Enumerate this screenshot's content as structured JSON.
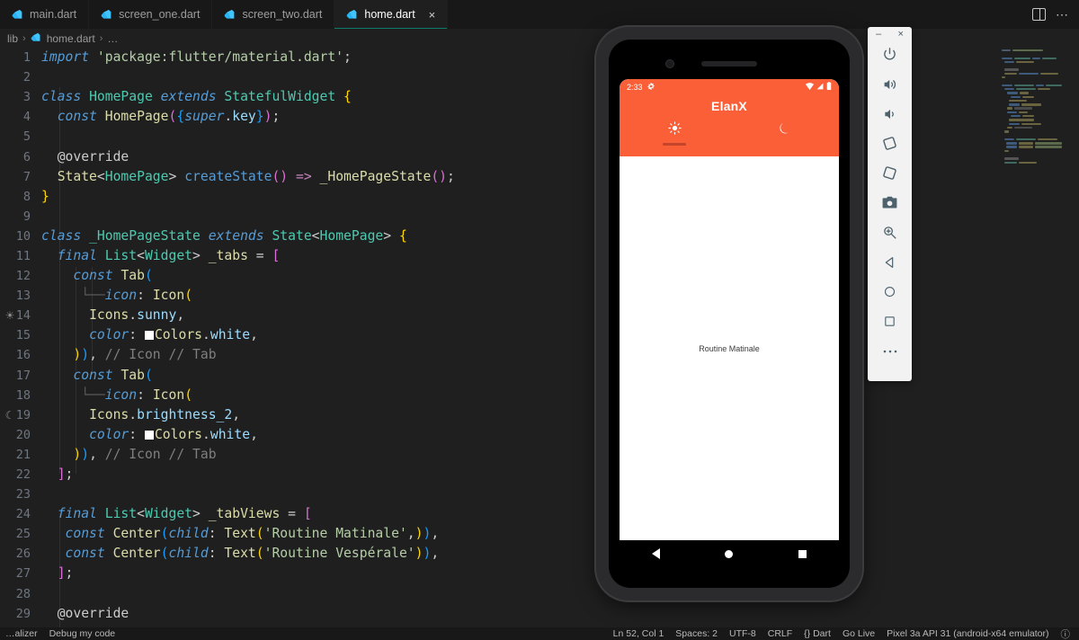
{
  "window": {
    "tabs": [
      {
        "label": "main.dart",
        "icon": "dart-logo-icon",
        "active": false,
        "closable": false
      },
      {
        "label": "screen_one.dart",
        "icon": "dart-logo-icon",
        "active": false,
        "closable": false
      },
      {
        "label": "screen_two.dart",
        "icon": "dart-logo-icon",
        "active": false,
        "closable": false
      },
      {
        "label": "home.dart",
        "icon": "dart-logo-icon",
        "active": true,
        "closable": true
      }
    ],
    "tab_close_glyph": "×",
    "actions": [
      {
        "name": "split-editor-icon",
        "label": ""
      },
      {
        "name": "more-actions-icon",
        "label": "⋯"
      }
    ]
  },
  "breadcrumb": {
    "root": "lib",
    "file": "home.dart",
    "tail": "…",
    "separator": "›"
  },
  "editor": {
    "language": "Dart",
    "gutter_icons": {
      "line14": "sun-icon",
      "line19": "moon-icon"
    },
    "lines": [
      {
        "n": "1",
        "text": "import 'package:flutter/material.dart';"
      },
      {
        "n": "2",
        "text": ""
      },
      {
        "n": "3",
        "text": "class HomePage extends StatefulWidget {"
      },
      {
        "n": "4",
        "text": "  const HomePage({super.key});"
      },
      {
        "n": "5",
        "text": ""
      },
      {
        "n": "6",
        "text": "  @override"
      },
      {
        "n": "7",
        "text": "  State<HomePage> createState() => _HomePageState();"
      },
      {
        "n": "8",
        "text": "}"
      },
      {
        "n": "9",
        "text": ""
      },
      {
        "n": "10",
        "text": "class _HomePageState extends State<HomePage> {"
      },
      {
        "n": "11",
        "text": "  final List<Widget> _tabs = ["
      },
      {
        "n": "12",
        "text": "    const Tab("
      },
      {
        "n": "13",
        "text": "      icon: Icon("
      },
      {
        "n": "14",
        "text": "      Icons.sunny,"
      },
      {
        "n": "15",
        "text": "      color: Colors.white,"
      },
      {
        "n": "16",
        "text": "    )), // Icon // Tab"
      },
      {
        "n": "17",
        "text": "    const Tab("
      },
      {
        "n": "18",
        "text": "      icon: Icon("
      },
      {
        "n": "19",
        "text": "      Icons.brightness_2,"
      },
      {
        "n": "20",
        "text": "      color: Colors.white,"
      },
      {
        "n": "21",
        "text": "    )), // Icon // Tab"
      },
      {
        "n": "22",
        "text": "  ];"
      },
      {
        "n": "23",
        "text": ""
      },
      {
        "n": "24",
        "text": "  final List<Widget> _tabViews = ["
      },
      {
        "n": "25",
        "text": "    const Center(child: Text('Routine Matinale',)),"
      },
      {
        "n": "26",
        "text": "    const Center(child: Text('Routine Vespérale')),"
      },
      {
        "n": "27",
        "text": "  ];"
      },
      {
        "n": "28",
        "text": ""
      },
      {
        "n": "29",
        "text": "  @override"
      }
    ]
  },
  "emulator": {
    "device_name": "Pixel 3a API 31 (android-x64 emulator)",
    "status_bar": {
      "time": "2:33",
      "settings_icon": "gear-icon",
      "wifi_icon": "wifi-icon",
      "signal_icon": "signal-icon",
      "battery_icon": "battery-icon"
    },
    "app": {
      "title": "ElanX",
      "accent_color": "#fb5f38",
      "indicator_color": "#c4452a",
      "tabs": [
        {
          "icon": "sun-icon",
          "glyph": "☀",
          "selected": true
        },
        {
          "icon": "moon-icon",
          "glyph": "☾",
          "selected": false
        }
      ],
      "body_text": "Routine Matinale"
    },
    "nav_bar": [
      {
        "name": "android-back-button",
        "icon": "triangle-back-icon"
      },
      {
        "name": "android-home-button",
        "icon": "circle-home-icon"
      },
      {
        "name": "android-recents-button",
        "icon": "square-recents-icon"
      }
    ],
    "toolbar": {
      "minimize_glyph": "–",
      "close_glyph": "×",
      "buttons": [
        {
          "name": "power-button",
          "icon": "power-icon"
        },
        {
          "name": "volume-up-button",
          "icon": "volume-up-icon"
        },
        {
          "name": "volume-down-button",
          "icon": "volume-down-icon"
        },
        {
          "name": "rotate-left-button",
          "icon": "rotate-left-icon"
        },
        {
          "name": "rotate-right-button",
          "icon": "rotate-right-icon"
        },
        {
          "name": "screenshot-button",
          "icon": "camera-icon"
        },
        {
          "name": "zoom-button",
          "icon": "magnifier-icon"
        },
        {
          "name": "back-button",
          "icon": "triangle-back-icon"
        },
        {
          "name": "home-button",
          "icon": "circle-home-icon"
        },
        {
          "name": "overview-button",
          "icon": "square-recents-icon"
        },
        {
          "name": "more-button",
          "icon": "ellipsis-icon"
        }
      ]
    }
  },
  "statusbar": {
    "left": [
      {
        "name": "statusbar-visualizer",
        "label": "…alizer"
      },
      {
        "name": "statusbar-debug-my-code",
        "label": "Debug my code"
      }
    ],
    "right": [
      {
        "name": "statusbar-cursor-position",
        "label": "Ln 52, Col 1"
      },
      {
        "name": "statusbar-indentation",
        "label": "Spaces: 2"
      },
      {
        "name": "statusbar-encoding",
        "label": "UTF-8"
      },
      {
        "name": "statusbar-eol",
        "label": "CRLF"
      },
      {
        "name": "statusbar-language",
        "label": "{} Dart"
      },
      {
        "name": "statusbar-go-live",
        "label": "Go Live"
      },
      {
        "name": "statusbar-device",
        "label": "Pixel 3a API 31 (android-x64 emulator)"
      },
      {
        "name": "statusbar-notifications",
        "label": "ⓘ"
      }
    ]
  }
}
